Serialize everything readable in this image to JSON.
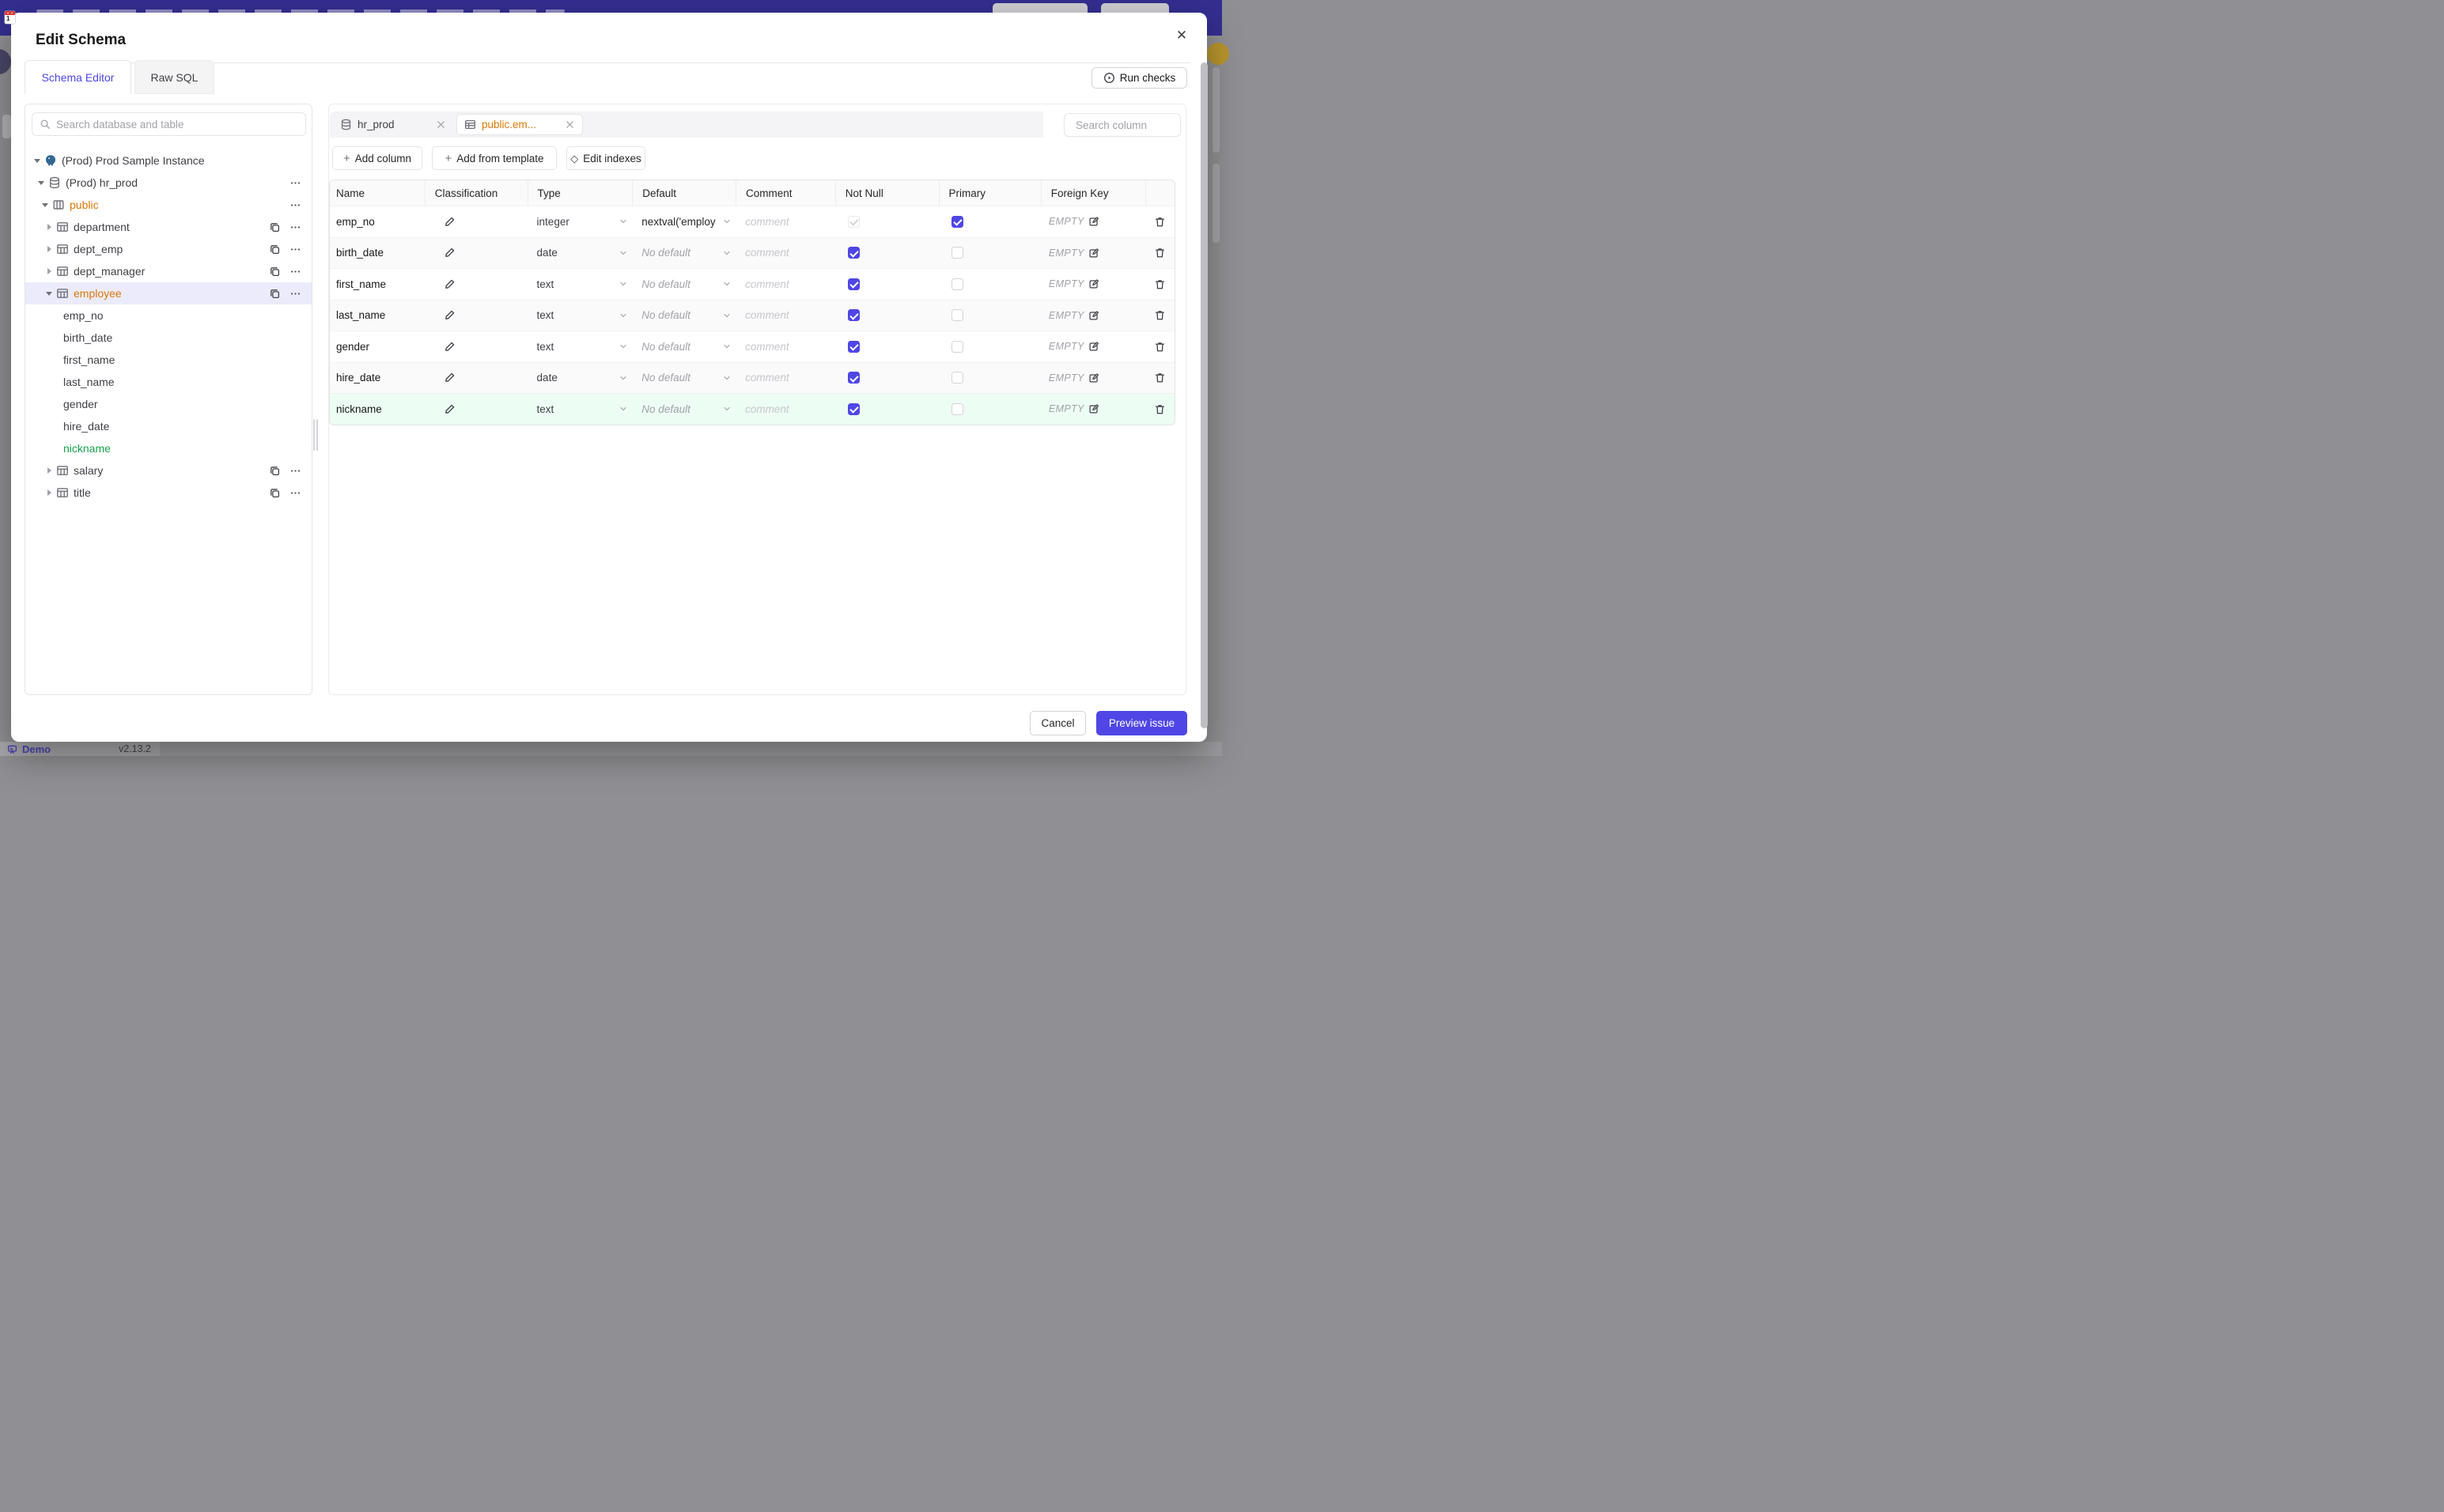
{
  "colors": {
    "accent": "#4f46e5",
    "modified_orange": "#d97706",
    "added_green": "#16a34a",
    "added_row_bg": "#ecfdf3",
    "selection_bg": "#ecebfb",
    "topbar_bg": "#342e90"
  },
  "backdrop_footer": {
    "brand": "Demo",
    "version": "v2.13.2"
  },
  "modal": {
    "title": "Edit Schema",
    "close_label": "✕",
    "tabs": [
      {
        "label": "Schema Editor",
        "active": true
      },
      {
        "label": "Raw SQL",
        "active": false
      }
    ],
    "run_checks_label": "Run checks"
  },
  "sidebar": {
    "search_placeholder": "Search database and table",
    "tree": {
      "instance_label": "(Prod) Prod Sample Instance",
      "database_label": "(Prod) hr_prod",
      "schema_label": "public",
      "schema_modified": true,
      "tables": [
        {
          "label": "department"
        },
        {
          "label": "dept_emp"
        },
        {
          "label": "dept_manager"
        },
        {
          "label": "employee",
          "selected": true,
          "modified": true,
          "expanded": true
        },
        {
          "label": "salary"
        },
        {
          "label": "title"
        }
      ],
      "employee_columns": [
        {
          "label": "emp_no"
        },
        {
          "label": "birth_date"
        },
        {
          "label": "first_name"
        },
        {
          "label": "last_name"
        },
        {
          "label": "gender"
        },
        {
          "label": "hire_date"
        },
        {
          "label": "nickname",
          "added": true
        }
      ]
    }
  },
  "editor": {
    "chips": [
      {
        "label": "hr_prod",
        "icon": "database-icon",
        "active": false
      },
      {
        "label": "public.em...",
        "icon": "table-icon",
        "active": true,
        "modified": true
      }
    ],
    "search_placeholder": "Search column",
    "actions": [
      "Add column",
      "Add from template",
      "Edit indexes"
    ],
    "table": {
      "headers": [
        "Name",
        "Classification",
        "Type",
        "Default",
        "Comment",
        "Not Null",
        "Primary",
        "Foreign Key"
      ],
      "comment_placeholder": "comment",
      "no_default_label": "No default",
      "fk_empty_label": "EMPTY",
      "rows": [
        {
          "name": "emp_no",
          "type": "integer",
          "default": "nextval('employ",
          "has_default": true,
          "not_null": true,
          "not_null_disabled": true,
          "primary": true,
          "added": false
        },
        {
          "name": "birth_date",
          "type": "date",
          "default": "",
          "has_default": false,
          "not_null": true,
          "primary": false,
          "added": false
        },
        {
          "name": "first_name",
          "type": "text",
          "default": "",
          "has_default": false,
          "not_null": true,
          "primary": false,
          "added": false
        },
        {
          "name": "last_name",
          "type": "text",
          "default": "",
          "has_default": false,
          "not_null": true,
          "primary": false,
          "added": false
        },
        {
          "name": "gender",
          "type": "text",
          "default": "",
          "has_default": false,
          "not_null": true,
          "primary": false,
          "added": false
        },
        {
          "name": "hire_date",
          "type": "date",
          "default": "",
          "has_default": false,
          "not_null": true,
          "primary": false,
          "added": false
        },
        {
          "name": "nickname",
          "type": "text",
          "default": "",
          "has_default": false,
          "not_null": true,
          "primary": false,
          "added": true
        }
      ]
    }
  },
  "footer": {
    "cancel_label": "Cancel",
    "submit_label": "Preview issue"
  },
  "icons": {
    "plus": "+",
    "diamond": "◇",
    "more": "⋯",
    "close": "✕"
  }
}
